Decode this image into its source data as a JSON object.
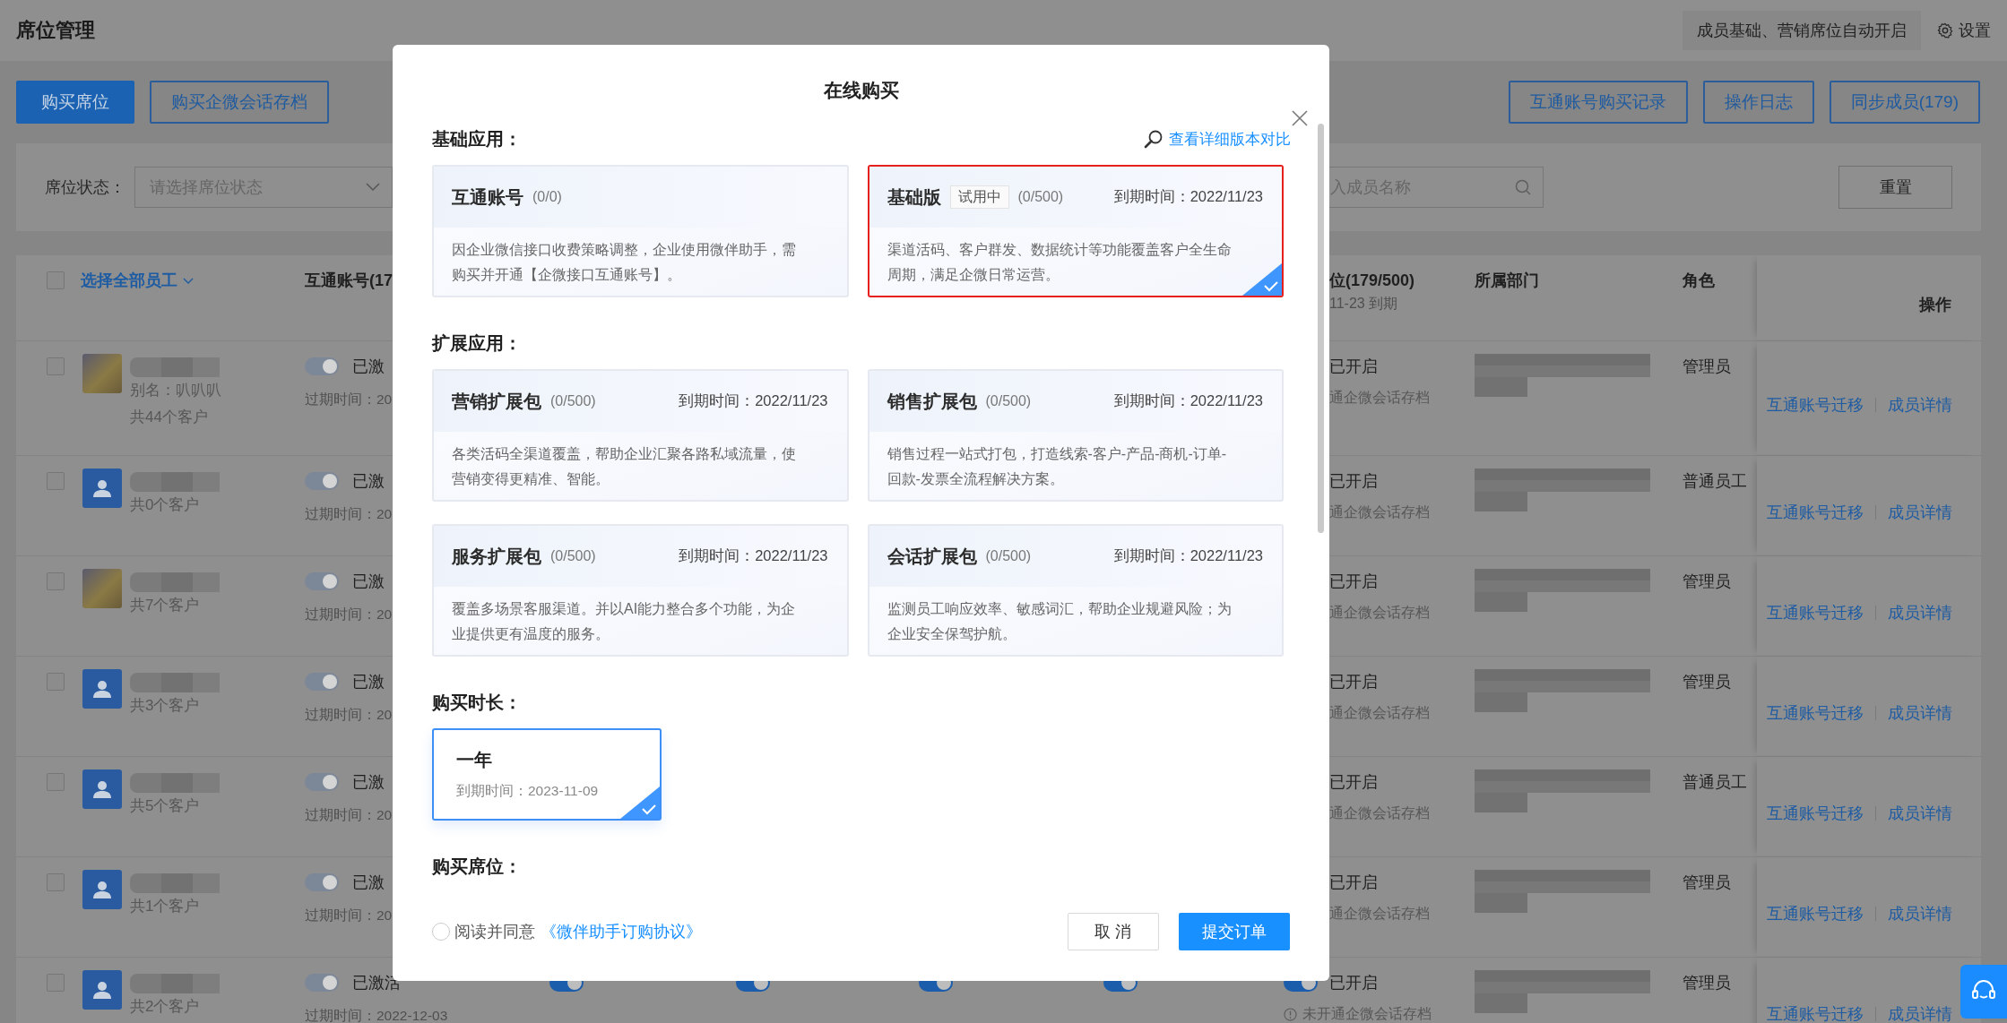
{
  "header": {
    "title": "席位管理",
    "auto_notice": "成员基础、营销席位自动开启",
    "settings": "设置"
  },
  "toolbar": {
    "left_buttons": [
      {
        "label": "购买席位",
        "kind": "primary"
      },
      {
        "label": "购买企微会话存档",
        "kind": "outline"
      }
    ],
    "right_buttons": [
      "互通账号购买记录",
      "操作日志",
      "同步成员(179)"
    ]
  },
  "filters": {
    "status_label": "席位状态：",
    "status_placeholder": "请选择席位状态",
    "search_placeholder": "入成员名称",
    "reset": "重置"
  },
  "table": {
    "columns": {
      "select_all_checked": false,
      "select_all": "选择全部员工",
      "hutong": "互通账号(17",
      "seat": "位(179/500)",
      "seat_sub": "11-23 到期",
      "department": "所属部门",
      "role": "角色",
      "actions": "操作"
    },
    "rows": [
      {
        "checked": false,
        "avatar": {
          "kind": "photo"
        },
        "alias": "别名：叭叭叭",
        "customers": "共44个客户",
        "hutong": {
          "on": true,
          "disabled": true,
          "status": "已激",
          "expiry": "过期时间：20"
        },
        "toggles": [],
        "seat": {
          "status": "已开启",
          "note": "通企微会话存档",
          "note_icon": false
        },
        "role": "管理员",
        "actions": [
          "互通账号迁移",
          "成员详情"
        ]
      },
      {
        "checked": false,
        "avatar": {
          "kind": "default"
        },
        "customers": "共0个客户",
        "hutong": {
          "on": true,
          "disabled": true,
          "status": "已激",
          "expiry": "过期时间：20"
        },
        "toggles": [],
        "seat": {
          "status": "已开启",
          "note": "通企微会话存档",
          "note_icon": false
        },
        "role": "普通员工",
        "actions": [
          "互通账号迁移",
          "成员详情"
        ]
      },
      {
        "checked": false,
        "avatar": {
          "kind": "photo"
        },
        "customers": "共7个客户",
        "hutong": {
          "on": true,
          "disabled": true,
          "status": "已激",
          "expiry": "过期时间：20"
        },
        "toggles": [],
        "seat": {
          "status": "已开启",
          "note": "通企微会话存档",
          "note_icon": false
        },
        "role": "管理员",
        "actions": [
          "互通账号迁移",
          "成员详情"
        ]
      },
      {
        "checked": false,
        "avatar": {
          "kind": "default"
        },
        "customers": "共3个客户",
        "hutong": {
          "on": true,
          "disabled": true,
          "status": "已激",
          "expiry": "过期时间：20"
        },
        "toggles": [],
        "seat": {
          "status": "已开启",
          "note": "通企微会话存档",
          "note_icon": false
        },
        "role": "管理员",
        "actions": [
          "互通账号迁移",
          "成员详情"
        ]
      },
      {
        "checked": false,
        "avatar": {
          "kind": "default"
        },
        "customers": "共5个客户",
        "hutong": {
          "on": true,
          "disabled": true,
          "status": "已激",
          "expiry": "过期时间：20"
        },
        "toggles": [],
        "seat": {
          "status": "已开启",
          "note": "通企微会话存档",
          "note_icon": false
        },
        "role": "普通员工",
        "actions": [
          "互通账号迁移",
          "成员详情"
        ]
      },
      {
        "checked": false,
        "avatar": {
          "kind": "default"
        },
        "customers": "共1个客户",
        "hutong": {
          "on": true,
          "disabled": true,
          "status": "已激",
          "expiry": "过期时间：20"
        },
        "toggles": [],
        "seat": {
          "status": "已开启",
          "note": "通企微会话存档",
          "note_icon": false
        },
        "role": "管理员",
        "actions": [
          "互通账号迁移",
          "成员详情"
        ]
      },
      {
        "checked": false,
        "avatar": {
          "kind": "default"
        },
        "customers": "共2个客户",
        "hutong": {
          "on": true,
          "disabled": true,
          "status": "已激活",
          "expiry": "过期时间：2022-12-03"
        },
        "toggles": [
          {
            "on": true
          },
          {
            "on": true
          },
          {
            "on": true
          },
          {
            "on": true
          }
        ],
        "seat": {
          "on": true,
          "status": "已开启",
          "note": "未开通企微会话存档",
          "note_icon": true
        },
        "role": "管理员",
        "actions": [
          "互通账号迁移",
          "成员详情"
        ]
      }
    ]
  },
  "dialog": {
    "title": "在线购买",
    "sections": [
      {
        "kind": "cards",
        "title": "基础应用：",
        "link": "查看详细版本对比",
        "cards": [
          {
            "name": "互通账号",
            "count": "(0/0)",
            "description": "因企业微信接口收费策略调整，企业使用微伴助手，需购买并开通【企微接口互通账号】。",
            "selected": false,
            "highlighted": false
          },
          {
            "name": "基础版",
            "tag": "试用中",
            "count": "(0/500)",
            "expiry": "到期时间：2022/11/23",
            "description": "渠道活码、客户群发、数据统计等功能覆盖客户全生命周期，满足企微日常运营。",
            "selected": true,
            "highlighted": true
          }
        ]
      },
      {
        "kind": "cards",
        "title": "扩展应用：",
        "cards": [
          {
            "name": "营销扩展包",
            "count": "(0/500)",
            "expiry": "到期时间：2022/11/23",
            "description": "各类活码全渠道覆盖，帮助企业汇聚各路私域流量，使营销变得更精准、智能。",
            "selected": false,
            "highlighted": false
          },
          {
            "name": "销售扩展包",
            "count": "(0/500)",
            "expiry": "到期时间：2022/11/23",
            "description": "销售过程一站式打包，打造线索-客户-产品-商机-订单-回款-发票全流程解决方案。",
            "selected": false,
            "highlighted": false
          },
          {
            "name": "服务扩展包",
            "count": "(0/500)",
            "expiry": "到期时间：2022/11/23",
            "description": "覆盖多场景客服渠道。并以AI能力整合多个功能，为企业提供更有温度的服务。",
            "selected": false,
            "highlighted": false
          },
          {
            "name": "会话扩展包",
            "count": "(0/500)",
            "expiry": "到期时间：2022/11/23",
            "description": "监测员工响应效率、敏感词汇，帮助企业规避风险；为企业安全保驾护航。",
            "selected": false,
            "highlighted": false
          }
        ]
      },
      {
        "kind": "durations",
        "title": "购买时长：",
        "options": [
          {
            "label": "一年",
            "expiry": "到期时间：2023-11-09",
            "selected": true
          }
        ]
      },
      {
        "kind": "heading",
        "title": "购买席位："
      }
    ],
    "agreement": {
      "checked": false,
      "text": "阅读并同意",
      "link": "《微伴助手订购协议》"
    },
    "buttons": [
      {
        "label": "取 消",
        "kind": "secondary"
      },
      {
        "label": "提交订单",
        "kind": "primary"
      }
    ]
  }
}
